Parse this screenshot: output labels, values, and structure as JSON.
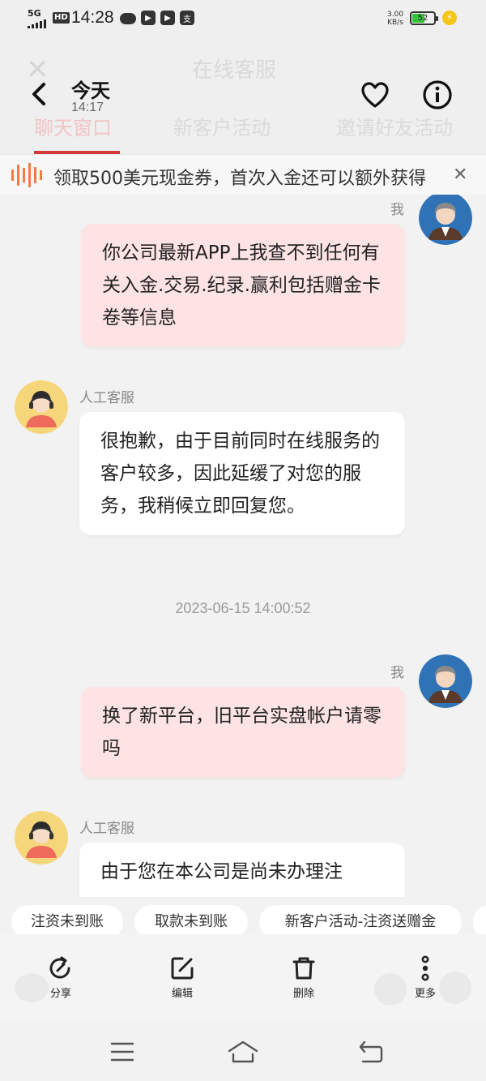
{
  "status_bar": {
    "network": "5G",
    "hd": "HD",
    "time": "14:28",
    "speed_value": "3.00",
    "speed_unit": "KB/s",
    "battery": "52",
    "battery_level": 0.52
  },
  "header": {
    "title": "今天",
    "subtitle": "14:17",
    "background_title": "在线客服",
    "tabs": [
      {
        "label": "聊天窗口",
        "active": true
      },
      {
        "label": "新客户活动",
        "active": false
      },
      {
        "label": "邀请好友活动",
        "active": false
      }
    ]
  },
  "banner": {
    "text": "领取500美元现金券，首次入金还可以额外获得"
  },
  "messages": [
    {
      "from": "me",
      "sender": "我",
      "text": "你公司最新APP上我查不到任何有关入金.交易.纪录.赢利包括赠金卡卷等信息"
    },
    {
      "from": "agent",
      "sender": "人工客服",
      "text": "很抱歉，由于目前同时在线服务的客户较多，因此延缓了对您的服务，我稍候立即回复您。"
    },
    {
      "timestamp": "2023-06-15 14:00:52"
    },
    {
      "from": "me",
      "sender": "我",
      "text": "换了新平台，旧平台实盘帐户请零吗"
    },
    {
      "from": "agent",
      "sender": "人工客服",
      "text": "由于您在本公司是尚未办理注"
    }
  ],
  "quick_replies": [
    "注资未到账",
    "取款未到账",
    "新客户活动-注资送赠金"
  ],
  "actions": [
    {
      "label": "分享",
      "icon": "share-icon"
    },
    {
      "label": "编辑",
      "icon": "edit-icon"
    },
    {
      "label": "删除",
      "icon": "trash-icon"
    },
    {
      "label": "更多",
      "icon": "more-icon"
    }
  ],
  "colors": {
    "accent": "#d13a3a",
    "my_bubble": "#fde3e4",
    "agent_bubble": "#ffffff",
    "banner_icon": "#ef7c45"
  }
}
